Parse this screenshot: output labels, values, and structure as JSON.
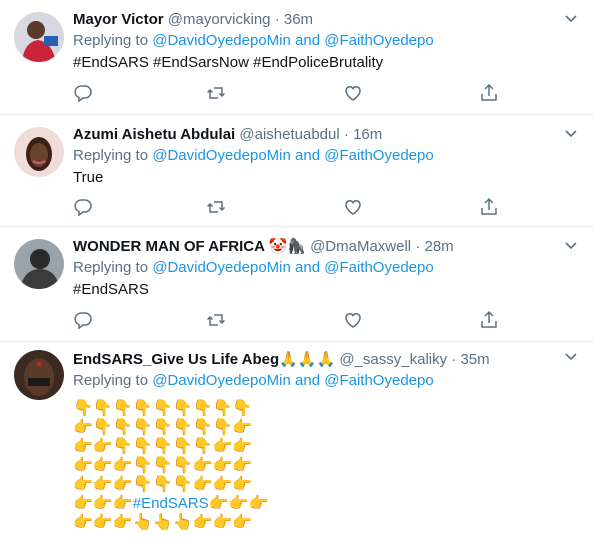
{
  "tweets": [
    {
      "name": "Mayor Victor",
      "handle": "@mayorvicking",
      "sep": "·",
      "time": "36m",
      "replying_label": "Replying to",
      "replying_1": "@DavidOyedepoMin",
      "replying_and": "and",
      "replying_2": "@FaithOyedepo",
      "body_link": "#EndSARS #EndSarsNow #EndPoliceBrutality"
    },
    {
      "name": "Azumi Aishetu Abdulai",
      "handle": "@aishetuabdul",
      "sep": "·",
      "time": "16m",
      "replying_label": "Replying to",
      "replying_1": "@DavidOyedepoMin",
      "replying_and": "and",
      "replying_2": "@FaithOyedepo",
      "body_text": "True"
    },
    {
      "name": "WONDER MAN OF AFRICA 🤡🦍",
      "handle": "@DmaMaxwell",
      "sep": "·",
      "time": "28m",
      "replying_label": "Replying to",
      "replying_1": "@DavidOyedepoMin",
      "replying_and": "and",
      "replying_2": "@FaithOyedepo",
      "body_link": "#EndSARS"
    },
    {
      "name": "EndSARS_Give Us Life Abeg🙏🙏🙏",
      "handle": "@_sassy_kaliky",
      "sep": "·",
      "time": "35m",
      "replying_label": "Replying to",
      "replying_1": "@DavidOyedepoMin",
      "replying_and": "and",
      "replying_2": "@FaithOyedepo",
      "emoji_rows": [
        "👇👇👇👇👇👇👇👇👇",
        "👉👇👇👇👇👇👇👇👉",
        "👉👉👇👇👇👇👇👉👉",
        "👉👉👉👇👇👇👉👉👉",
        "👉👉👉👇👇👇👉👉👉",
        "👉👉👉",
        "👉👉👉👆👆👆👉👉👉"
      ],
      "emoji_hashtag_prefix": "👉👉👉",
      "emoji_hashtag": "#EndSARS",
      "emoji_hashtag_suffix": "👉👉👉"
    }
  ],
  "icons": [
    "reply-icon",
    "retweet-icon",
    "like-icon",
    "share-icon",
    "chevron-down-icon"
  ],
  "colors": {
    "link": "#1b95e0",
    "muted": "#5b7083",
    "text": "#0f1419",
    "divider": "#e6ecf0"
  }
}
